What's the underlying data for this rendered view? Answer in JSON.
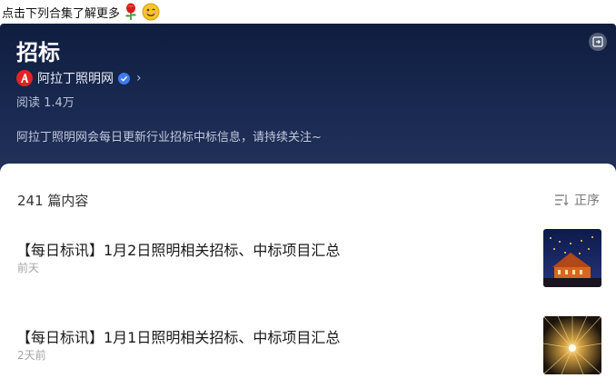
{
  "promo": {
    "text": "点击下列合集了解更多",
    "emojis": [
      "rose",
      "smiling-face"
    ]
  },
  "collection": {
    "title": "招标",
    "account_name": "阿拉丁照明网",
    "reads": "阅读 1.4万",
    "description": "阿拉丁照明网会每日更新行业招标中标信息，请持续关注~"
  },
  "list": {
    "count_label": "241 篇内容",
    "sort_label": "正序",
    "articles": [
      {
        "title": "【每日标讯】1月2日照明相关招标、中标项目汇总",
        "time": "前天"
      },
      {
        "title": "【每日标讯】1月1日照明相关招标、中标项目汇总",
        "time": "2天前"
      }
    ]
  },
  "colors": {
    "header_bg": "#1a2a52",
    "accent_red": "#e02424",
    "verify_blue": "#3c7bf0"
  }
}
